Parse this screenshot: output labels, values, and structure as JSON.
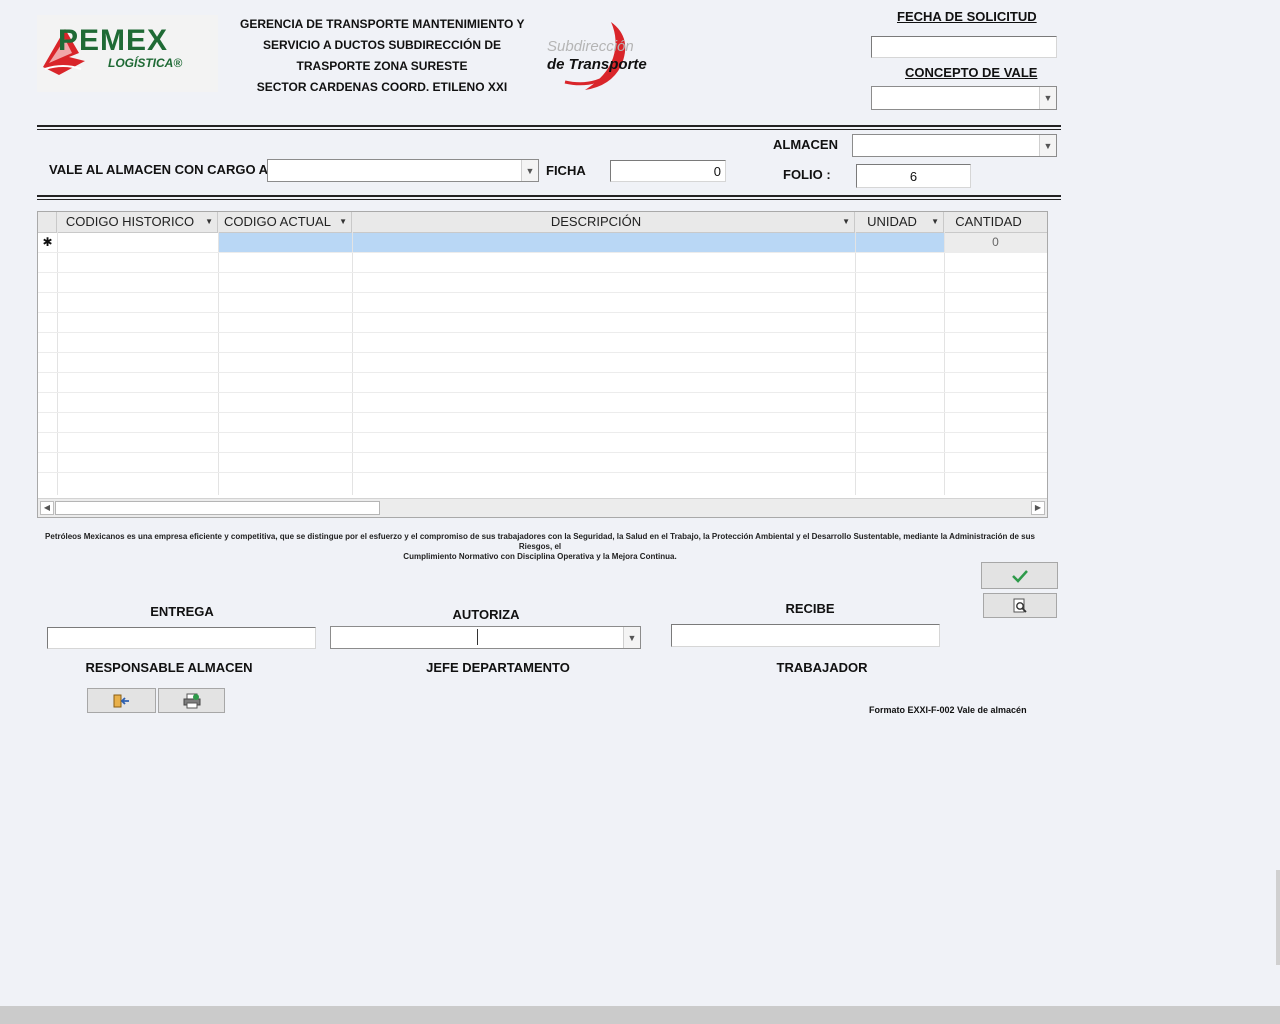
{
  "header": {
    "logo": {
      "brand": "PEMEX",
      "sub": "LOGÍSTICA®"
    },
    "org_lines": [
      "GERENCIA DE TRANSPORTE MANTENIMIENTO Y",
      "SERVICIO A DUCTOS SUBDIRECCIÓN DE",
      "TRASPORTE ZONA SURESTE",
      "SECTOR CARDENAS COORD. ETILENO XXI"
    ],
    "sub_logo": {
      "line1": "Subdirección",
      "line2": "de Transporte"
    }
  },
  "form": {
    "fecha_solicitud_label": "FECHA DE SOLICITUD",
    "fecha_solicitud_value": "",
    "concepto_vale_label": "CONCEPTO DE VALE",
    "concepto_vale_value": "",
    "almacen_label": "ALMACEN",
    "almacen_value": "",
    "vale_cargo_label": "VALE AL ALMACEN CON CARGO A:",
    "vale_cargo_value": "",
    "ficha_label": "FICHA",
    "ficha_value": "0",
    "folio_label": "FOLIO :",
    "folio_value": "6"
  },
  "grid": {
    "columns": [
      "CODIGO HISTORICO",
      "CODIGO ACTUAL",
      "DESCRIPCIÓN",
      "UNIDAD",
      "CANTIDAD"
    ],
    "new_row_marker": "✱",
    "new_row_cantidad": "0",
    "rows": []
  },
  "mission_text": {
    "line1": "Petróleos Mexicanos es una empresa eficiente y competitiva, que se distingue por el esfuerzo y el compromiso de sus trabajadores con la Seguridad, la Salud en el Trabajo, la Protección Ambiental y el Desarrollo Sustentable, mediante la Administración de sus Riesgos, el",
    "line2": "Cumplimiento Normativo con Disciplina Operativa y la Mejora Continua."
  },
  "signatures": {
    "entrega_label": "ENTREGA",
    "entrega_value": "",
    "entrega_role": "RESPONSABLE ALMACEN",
    "autoriza_label": "AUTORIZA",
    "autoriza_value": "",
    "autoriza_role": "JEFE DEPARTAMENTO",
    "recibe_label": "RECIBE",
    "recibe_value": "",
    "recibe_role": "TRABAJADOR"
  },
  "footer": {
    "format_code": "Formato EXXI-F-002 Vale de almacén"
  },
  "icons": {
    "confirm": "check-icon",
    "preview": "print-preview-icon",
    "exit": "exit-door-icon",
    "print": "printer-icon"
  },
  "colors": {
    "brand_green": "#1f6a35",
    "brand_red": "#d9252a",
    "selection": "#b9d7f5",
    "check_green": "#2e9a4a"
  }
}
